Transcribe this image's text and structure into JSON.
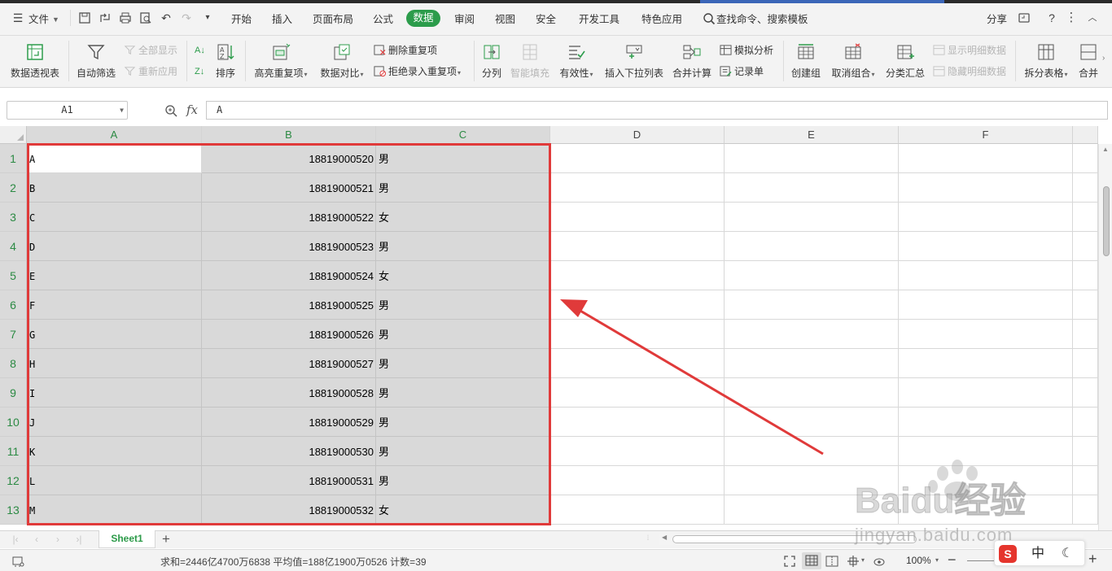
{
  "menu": {
    "file": "文件",
    "tabs": [
      "开始",
      "插入",
      "页面布局",
      "公式",
      "数据",
      "审阅",
      "视图",
      "安全",
      "开发工具",
      "特色应用"
    ],
    "search": "查找命令、搜索模板",
    "share": "分享"
  },
  "ribbon": {
    "pivot": "数据透视表",
    "autofilter": "自动筛选",
    "show_all": "全部显示",
    "reapply": "重新应用",
    "sort": "排序",
    "highlight_dup": "高亮重复项",
    "compare": "数据对比",
    "remove_dup": "删除重复项",
    "reject_dup": "拒绝录入重复项",
    "split": "分列",
    "smart_fill": "智能填充",
    "validity": "有效性",
    "insert_dropdown": "插入下拉列表",
    "consolidate": "合并计算",
    "what_if": "模拟分析",
    "form": "记录单",
    "group": "创建组",
    "ungroup": "取消组合",
    "subtotal": "分类汇总",
    "show_detail": "显示明细数据",
    "hide_detail": "隐藏明细数据",
    "split_table": "拆分表格",
    "merge": "合并"
  },
  "formula_bar": {
    "name_box": "A1",
    "fx": "fx",
    "content": "A"
  },
  "grid": {
    "columns": [
      "A",
      "B",
      "C",
      "D",
      "E",
      "F"
    ],
    "rows": [
      {
        "num": "1",
        "a": "A",
        "b": "18819000520",
        "c": "男"
      },
      {
        "num": "2",
        "a": "B",
        "b": "18819000521",
        "c": "男"
      },
      {
        "num": "3",
        "a": "C",
        "b": "18819000522",
        "c": "女"
      },
      {
        "num": "4",
        "a": "D",
        "b": "18819000523",
        "c": "男"
      },
      {
        "num": "5",
        "a": "E",
        "b": "18819000524",
        "c": "女"
      },
      {
        "num": "6",
        "a": "F",
        "b": "18819000525",
        "c": "男"
      },
      {
        "num": "7",
        "a": "G",
        "b": "18819000526",
        "c": "男"
      },
      {
        "num": "8",
        "a": "H",
        "b": "18819000527",
        "c": "男"
      },
      {
        "num": "9",
        "a": "I",
        "b": "18819000528",
        "c": "男"
      },
      {
        "num": "10",
        "a": "J",
        "b": "18819000529",
        "c": "男"
      },
      {
        "num": "11",
        "a": "K",
        "b": "18819000530",
        "c": "男"
      },
      {
        "num": "12",
        "a": "L",
        "b": "18819000531",
        "c": "男"
      },
      {
        "num": "13",
        "a": "M",
        "b": "18819000532",
        "c": "女"
      }
    ]
  },
  "sheets": {
    "active": "Sheet1"
  },
  "status": {
    "summary": "求和=2446亿4700万6838   平均值=188亿1900万0526   计数=39",
    "zoom": "100%"
  },
  "watermark": {
    "brand": "Baidu经验",
    "url": "jingyan.baidu.com"
  },
  "ime": {
    "logo": "S",
    "mode": "中"
  },
  "colors": {
    "accent_green": "#2c9c4b",
    "selection_gray": "#d9d9d9",
    "annotation_red": "#e03a3a"
  }
}
